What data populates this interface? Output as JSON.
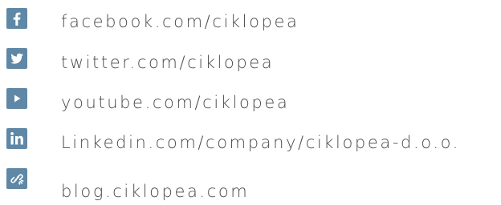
{
  "links": [
    {
      "icon": "facebook-icon",
      "text": "facebook.com/ciklopea"
    },
    {
      "icon": "twitter-icon",
      "text": "twitter.com/ciklopea"
    },
    {
      "icon": "youtube-icon",
      "text": "youtube.com/ciklopea"
    },
    {
      "icon": "linkedin-icon",
      "text": "Linkedin.com/company/ciklopea-d.o.o."
    },
    {
      "icon": "link-icon",
      "text": "blog.ciklopea.com"
    }
  ],
  "colors": {
    "icon_background": "#5f87a6",
    "text": "#4a4a4a"
  }
}
